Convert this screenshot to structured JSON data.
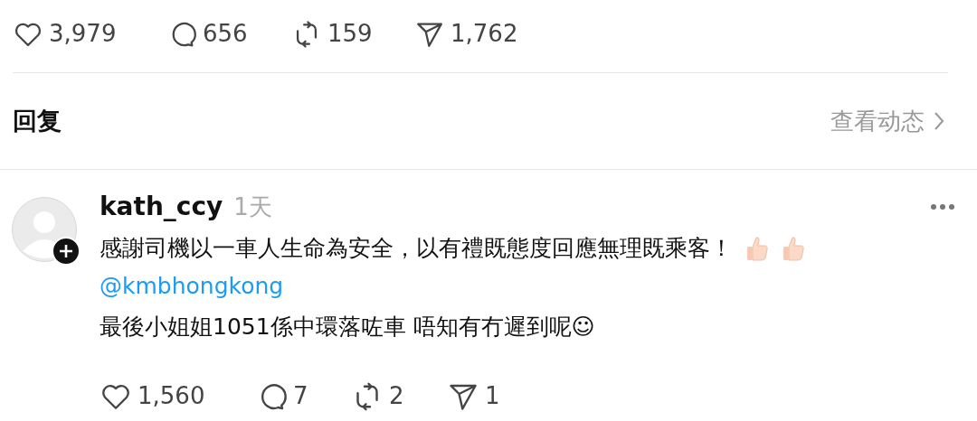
{
  "post_stats": [
    {
      "kind": "like",
      "count": "3,979"
    },
    {
      "kind": "comment",
      "count": "656"
    },
    {
      "kind": "repost",
      "count": "159"
    },
    {
      "kind": "share",
      "count": "1,762"
    }
  ],
  "replies_header": {
    "title": "回复",
    "link": "查看动态"
  },
  "comment": {
    "username": "kath_ccy",
    "time": "1天",
    "lines": [
      {
        "kind": "text",
        "text": "感謝司機以一車人生命為安全，以有禮既態度回應無理既乘客！",
        "emojis": [
          {
            "kind": "thumbs_up"
          },
          {
            "kind": "thumbs_up"
          }
        ]
      },
      {
        "kind": "mention",
        "text": "@kmbhongkong"
      },
      {
        "kind": "text",
        "text": "最後小姐姐1051係中環落咗車 唔知有冇遲到呢☺"
      }
    ],
    "stats": [
      {
        "kind": "like",
        "count": "1,560"
      },
      {
        "kind": "comment",
        "count": "7"
      },
      {
        "kind": "repost",
        "count": "2"
      },
      {
        "kind": "share",
        "count": "1"
      }
    ]
  }
}
